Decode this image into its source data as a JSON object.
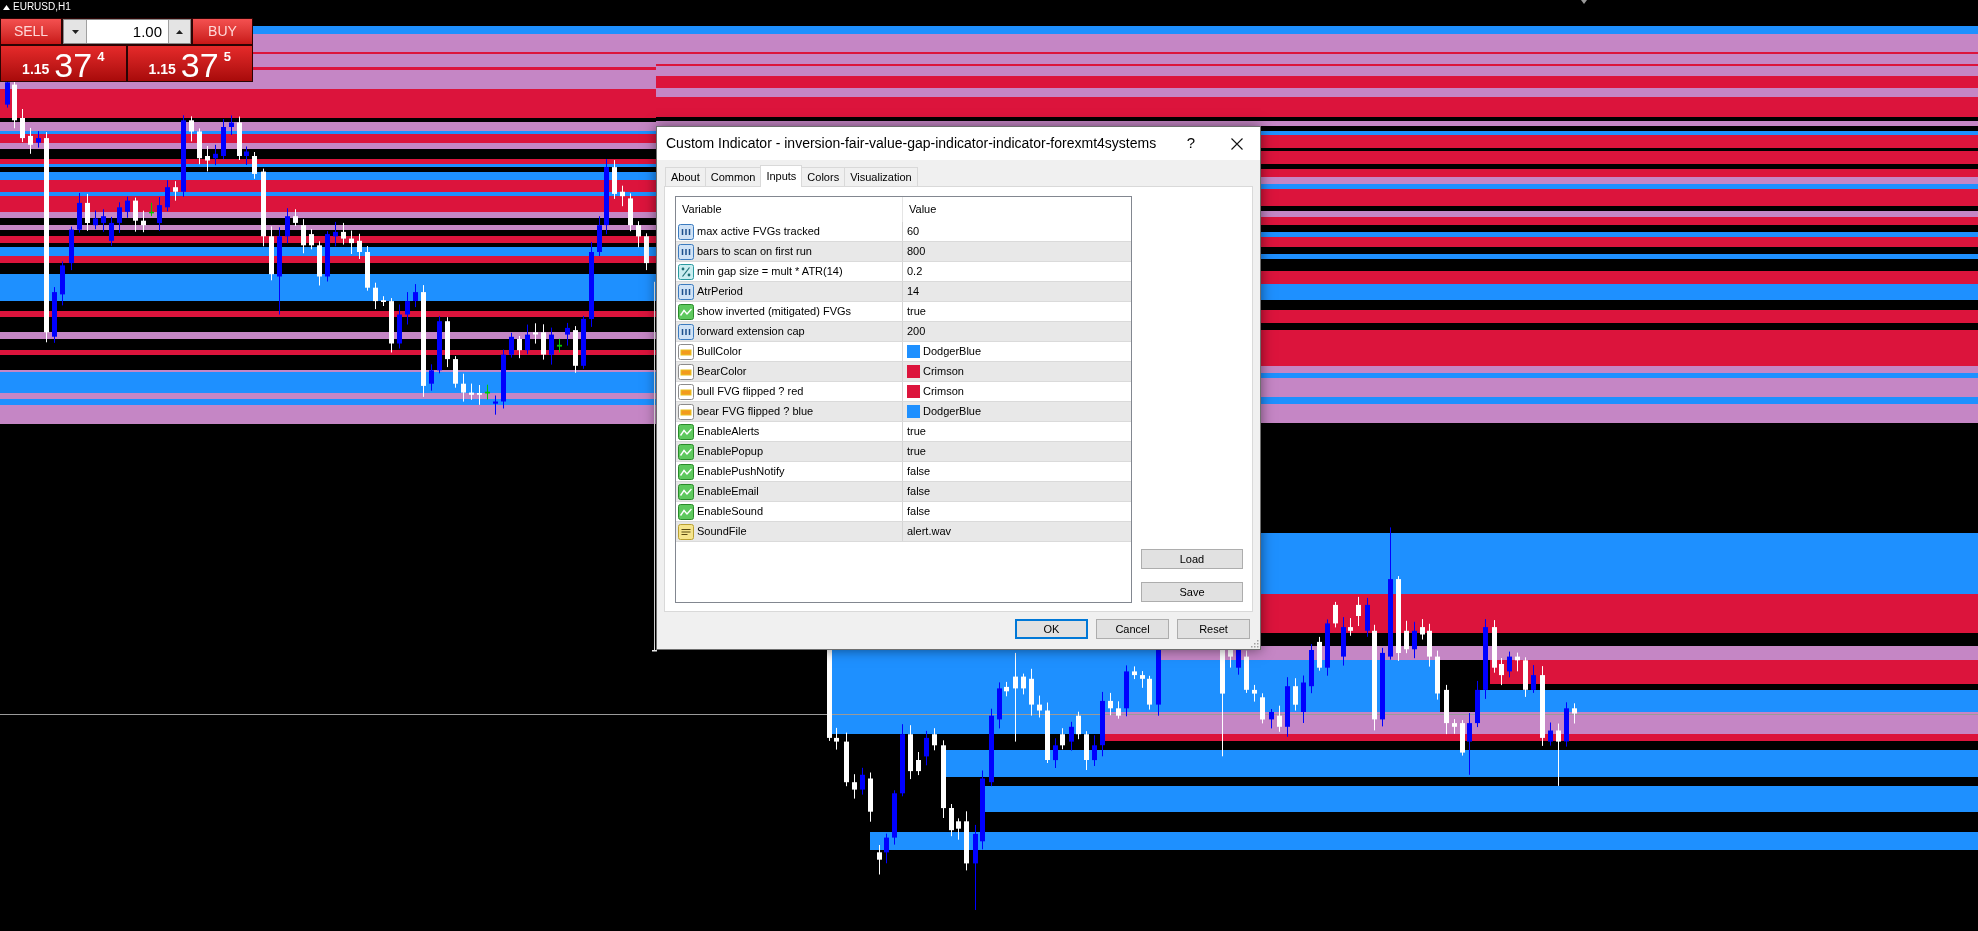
{
  "chart": {
    "symbol": "EURUSD,H1"
  },
  "trade_panel": {
    "sell": {
      "label": "SELL",
      "price": {
        "prefix": "1.15",
        "pips": "37",
        "point": "4"
      }
    },
    "lot": "1.00",
    "buy": {
      "label": "BUY",
      "price": {
        "prefix": "1.15",
        "pips": "37",
        "point": "5"
      }
    }
  },
  "dialog": {
    "title": "Custom Indicator - inversion-fair-value-gap-indicator-indicator-forexmt4systems",
    "help": "?",
    "tabs": [
      {
        "label": "About",
        "selected": false
      },
      {
        "label": "Common",
        "selected": false
      },
      {
        "label": "Inputs",
        "selected": true
      },
      {
        "label": "Colors",
        "selected": false
      },
      {
        "label": "Visualization",
        "selected": false
      }
    ],
    "table": {
      "columns": [
        "Variable",
        "Value"
      ],
      "rows": [
        {
          "kind": "int",
          "variable": "max active FVGs tracked",
          "value": "60"
        },
        {
          "kind": "int",
          "variable": "bars to scan on first run",
          "value": "800"
        },
        {
          "kind": "double",
          "variable": "min gap size = mult * ATR(14)",
          "value": "0.2"
        },
        {
          "kind": "int",
          "variable": "AtrPeriod",
          "value": "14"
        },
        {
          "kind": "bool",
          "variable": "show inverted (mitigated) FVGs",
          "value": "true"
        },
        {
          "kind": "int",
          "variable": "forward extension cap",
          "value": "200"
        },
        {
          "kind": "color",
          "variable": "BullColor",
          "value": "DodgerBlue",
          "color": "#1e90ff"
        },
        {
          "kind": "color",
          "variable": "BearColor",
          "value": "Crimson",
          "color": "#dc143c"
        },
        {
          "kind": "color",
          "variable": "bull FVG flipped ? red",
          "value": "Crimson",
          "color": "#dc143c"
        },
        {
          "kind": "color",
          "variable": "bear FVG flipped ? blue",
          "value": "DodgerBlue",
          "color": "#1e90ff"
        },
        {
          "kind": "bool",
          "variable": "EnableAlerts",
          "value": "true"
        },
        {
          "kind": "bool",
          "variable": "EnablePopup",
          "value": "true"
        },
        {
          "kind": "bool",
          "variable": "EnablePushNotify",
          "value": "false"
        },
        {
          "kind": "bool",
          "variable": "EnableEmail",
          "value": "false"
        },
        {
          "kind": "bool",
          "variable": "EnableSound",
          "value": "false"
        },
        {
          "kind": "string",
          "variable": "SoundFile",
          "value": "alert.wav"
        }
      ]
    },
    "side_buttons": [
      "Load",
      "Save"
    ],
    "buttons": [
      {
        "label": "OK",
        "focused": true
      },
      {
        "label": "Cancel",
        "focused": false
      },
      {
        "label": "Reset",
        "focused": false
      }
    ]
  }
}
